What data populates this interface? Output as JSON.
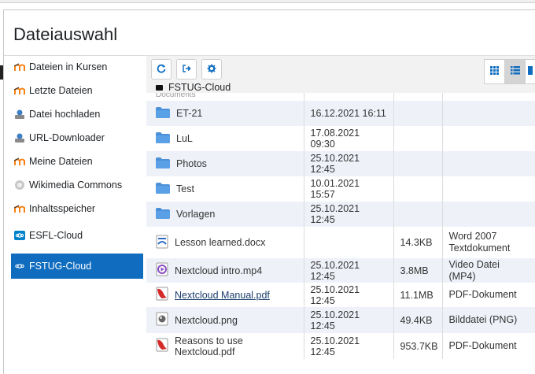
{
  "dialog": {
    "title": "Dateiauswahl"
  },
  "sidebar": {
    "items": [
      {
        "label": "Dateien in Kursen",
        "icon": "moodle-icon"
      },
      {
        "label": "Letzte Dateien",
        "icon": "moodle-icon"
      },
      {
        "label": "Datei hochladen",
        "icon": "upload-icon"
      },
      {
        "label": "URL-Downloader",
        "icon": "url-downloader-icon"
      },
      {
        "label": "Meine Dateien",
        "icon": "moodle-icon"
      },
      {
        "label": "Wikimedia Commons",
        "icon": "wikimedia-icon"
      },
      {
        "label": "Inhaltsspeicher",
        "icon": "moodle-icon"
      },
      {
        "label": "ESFL-Cloud",
        "icon": "nextcloud-icon"
      },
      {
        "label": "FSTUG-Cloud",
        "icon": "nextcloud-icon",
        "active": true
      }
    ]
  },
  "toolbar": {
    "refresh": "refresh-icon",
    "logout": "logout-icon",
    "settings": "gear-icon",
    "views": [
      "icons-view-icon",
      "list-view-icon",
      "tree-view-icon"
    ]
  },
  "path": {
    "current": "FSTUG-Cloud"
  },
  "partial_row": {
    "name": "Documents"
  },
  "files": [
    {
      "name": "ET-21",
      "date": "16.12.2021 16:11",
      "size": "",
      "type": "",
      "kind": "folder"
    },
    {
      "name": "LuL",
      "date": "17.08.2021 09:30",
      "size": "",
      "type": "",
      "kind": "folder"
    },
    {
      "name": "Photos",
      "date": "25.10.2021 12:45",
      "size": "",
      "type": "",
      "kind": "folder"
    },
    {
      "name": "Test",
      "date": "10.01.2021 15:57",
      "size": "",
      "type": "",
      "kind": "folder"
    },
    {
      "name": "Vorlagen",
      "date": "25.10.2021 12:45",
      "size": "",
      "type": "",
      "kind": "folder"
    },
    {
      "name": "Lesson learned.docx",
      "date": "",
      "size": "14.3KB",
      "type": "Word 2007 Textdokument",
      "kind": "docx"
    },
    {
      "name": "Nextcloud intro.mp4",
      "date": "25.10.2021 12:45",
      "size": "3.8MB",
      "type": "Video Datei (MP4)",
      "kind": "video"
    },
    {
      "name": "Nextcloud Manual.pdf",
      "date": "25.10.2021 12:45",
      "size": "11.1MB",
      "type": "PDF-Dokument",
      "kind": "pdf",
      "link": true
    },
    {
      "name": "Nextcloud.png",
      "date": "25.10.2021 12:45",
      "size": "49.4KB",
      "type": "Bilddatei (PNG)",
      "kind": "image"
    },
    {
      "name": "Reasons to use Nextcloud.pdf",
      "date": "25.10.2021 12:45",
      "size": "953.7KB",
      "type": "PDF-Dokument",
      "kind": "pdf"
    }
  ],
  "colors": {
    "accent": "#0f6cbf",
    "folder": "#4a90d9",
    "row_alt": "#eef2f8"
  }
}
